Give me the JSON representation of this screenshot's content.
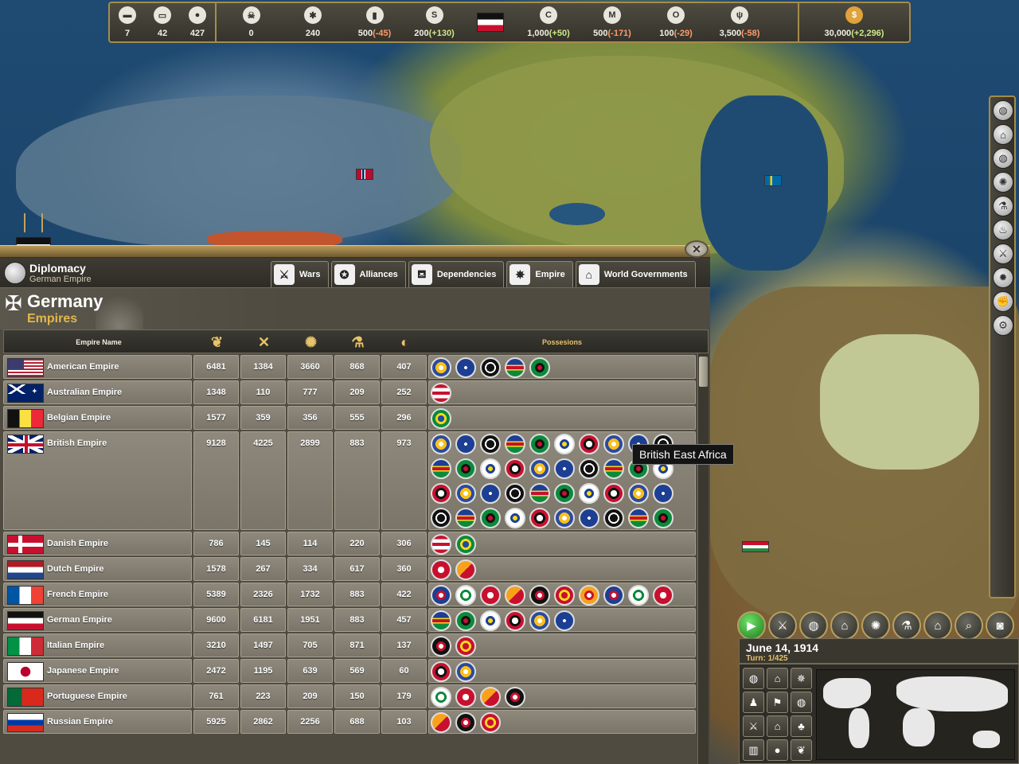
{
  "topbar": {
    "left_resources": [
      {
        "icon": "truck-icon",
        "value": "7"
      },
      {
        "icon": "rail-car-icon",
        "value": "42"
      },
      {
        "icon": "grain-sack-icon",
        "value": "427"
      }
    ],
    "mid_resources": [
      {
        "icon": "gas-mask-icon",
        "value": "0",
        "delta": ""
      },
      {
        "icon": "artillery-icon",
        "value": "240",
        "delta": ""
      },
      {
        "icon": "fuel-can-icon",
        "value": "500",
        "delta": "(-45)",
        "sign": "neg"
      },
      {
        "icon": "steel-icon",
        "value": "200",
        "delta": "(+130)",
        "sign": "pos"
      }
    ],
    "right_resources": [
      {
        "icon": "coal-icon",
        "value": "1,000",
        "delta": "(+50)",
        "sign": "pos"
      },
      {
        "icon": "metal-icon",
        "value": "500",
        "delta": "(-171)",
        "sign": "neg"
      },
      {
        "icon": "oil-icon",
        "value": "100",
        "delta": "(-29)",
        "sign": "neg"
      },
      {
        "icon": "wheat-icon",
        "value": "3,500",
        "delta": "(-58)",
        "sign": "neg"
      }
    ],
    "money": {
      "icon": "dollar-icon",
      "value": "30,000",
      "delta": "(+2,296)",
      "sign": "pos"
    }
  },
  "panel": {
    "title": "Diplomacy",
    "subtitle": "German Empire",
    "close": "✕",
    "tabs": [
      {
        "label": "Wars",
        "icon": "shield-swords-icon"
      },
      {
        "label": "Alliances",
        "icon": "star-icon"
      },
      {
        "label": "Dependencies",
        "icon": "bell-icon"
      },
      {
        "label": "Empire",
        "icon": "compass-star-icon",
        "active": true
      },
      {
        "label": "World Governments",
        "icon": "capitol-icon"
      }
    ],
    "nation_name": "Germany",
    "section": "Empires",
    "columns": {
      "name": "Empire Name",
      "stat_icons": [
        "laurel-icon",
        "crossed-swords-icon",
        "gear-icon",
        "flask-icon",
        "ball-icon"
      ],
      "possessions": "Possesions"
    }
  },
  "empires": [
    {
      "name": "American Empire",
      "flag": "us",
      "stats": [
        "6481",
        "1384",
        "3660",
        "868",
        "407"
      ],
      "possessions": 5
    },
    {
      "name": "Australian Empire",
      "flag": "au",
      "stats": [
        "1348",
        "110",
        "777",
        "209",
        "252"
      ],
      "possessions": 1
    },
    {
      "name": "Belgian Empire",
      "flag": "be",
      "stats": [
        "1577",
        "359",
        "356",
        "555",
        "296"
      ],
      "possessions": 1
    },
    {
      "name": "British Empire",
      "flag": "gb",
      "stats": [
        "9128",
        "4225",
        "2899",
        "883",
        "973"
      ],
      "possessions": 44
    },
    {
      "name": "Danish Empire",
      "flag": "dk",
      "stats": [
        "786",
        "145",
        "114",
        "220",
        "306"
      ],
      "possessions": 2
    },
    {
      "name": "Dutch Empire",
      "flag": "nl",
      "stats": [
        "1578",
        "267",
        "334",
        "617",
        "360"
      ],
      "possessions": 2
    },
    {
      "name": "French Empire",
      "flag": "fr",
      "stats": [
        "5389",
        "2326",
        "1732",
        "883",
        "422"
      ],
      "possessions": 10
    },
    {
      "name": "German Empire",
      "flag": "de",
      "stats": [
        "9600",
        "6181",
        "1951",
        "883",
        "457"
      ],
      "possessions": 6
    },
    {
      "name": "Italian Empire",
      "flag": "it",
      "stats": [
        "3210",
        "1497",
        "705",
        "871",
        "137"
      ],
      "possessions": 2
    },
    {
      "name": "Japanese Empire",
      "flag": "jp",
      "stats": [
        "2472",
        "1195",
        "639",
        "569",
        "60"
      ],
      "possessions": 2
    },
    {
      "name": "Portuguese Empire",
      "flag": "pt",
      "stats": [
        "761",
        "223",
        "209",
        "150",
        "179"
      ],
      "possessions": 4
    },
    {
      "name": "Russian Empire",
      "flag": "ru",
      "stats": [
        "5925",
        "2862",
        "2256",
        "688",
        "103"
      ],
      "possessions": 3
    }
  ],
  "tooltip": "British East Africa",
  "date": {
    "date": "June 14, 1914",
    "turn": "Turn: 1/425"
  },
  "colors": {
    "gold": "#e7c36a",
    "panel": "#4f4b41",
    "cell": "#8e897c",
    "border": "#a48c4c"
  }
}
